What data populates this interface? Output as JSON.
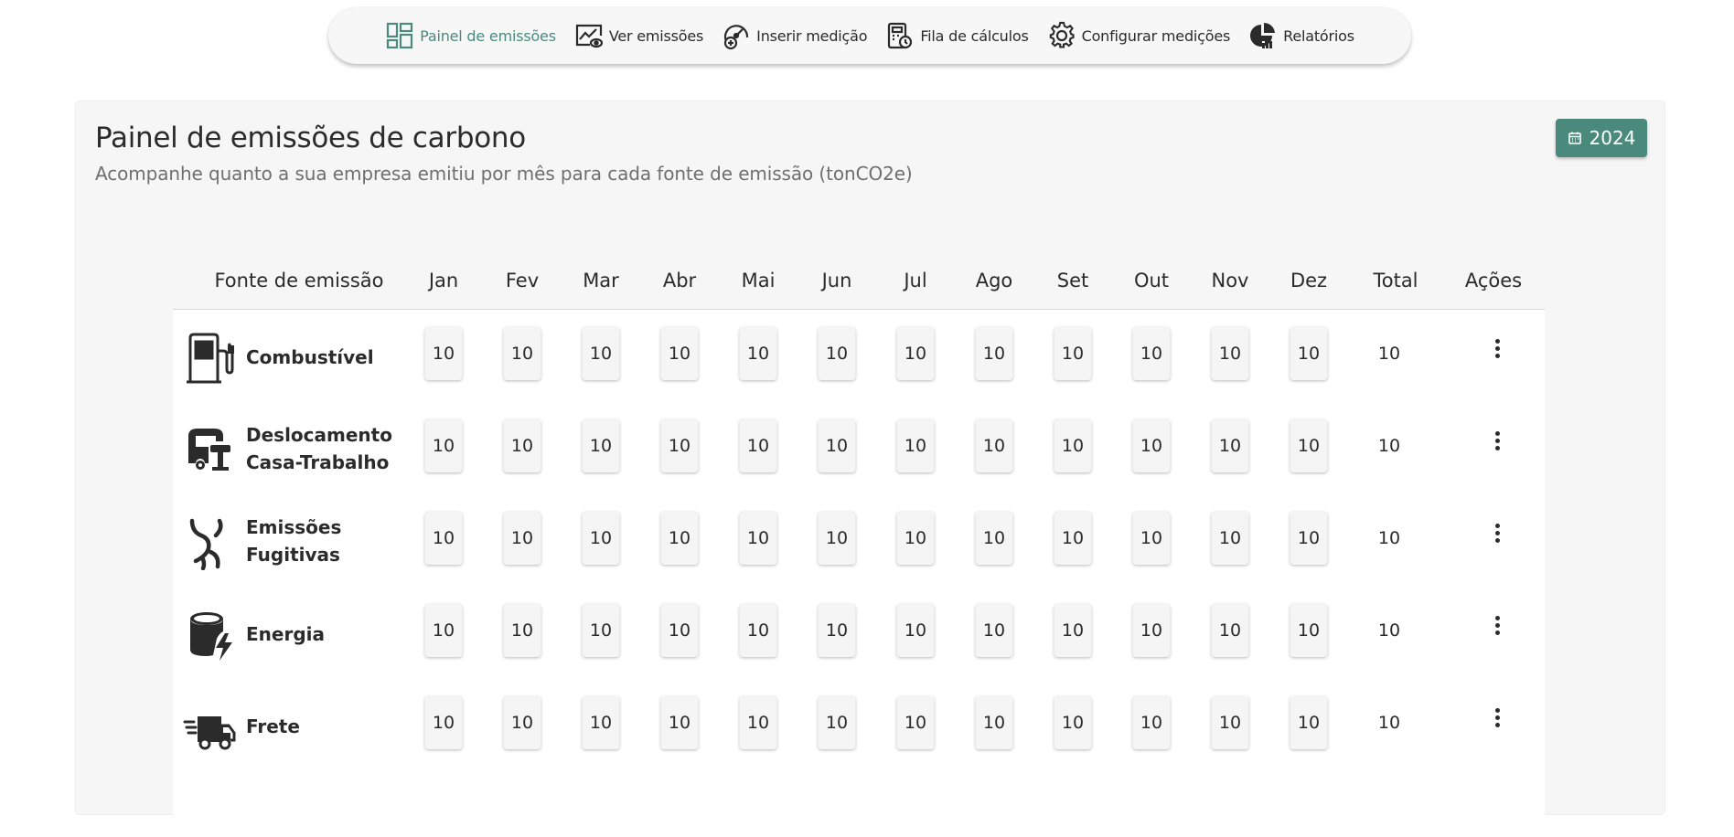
{
  "nav": {
    "items": [
      {
        "label": "Painel de emissões",
        "icon": "dashboard-icon",
        "active": true
      },
      {
        "label": "Ver emissões",
        "icon": "chart-eye-icon",
        "active": false
      },
      {
        "label": "Inserir medição",
        "icon": "gauge-add-icon",
        "active": false
      },
      {
        "label": "Fila de cálculos",
        "icon": "calculator-queue-icon",
        "active": false
      },
      {
        "label": "Configurar medições",
        "icon": "gear-icon",
        "active": false
      },
      {
        "label": "Relatórios",
        "icon": "report-chart-icon",
        "active": false
      }
    ],
    "active_color": "#4a8a7c"
  },
  "header": {
    "title": "Painel de emissões de carbono",
    "subtitle": "Acompanhe quanto a sua empresa emitiu por mês para cada fonte de emissão (tonCO2e)",
    "year": "2024"
  },
  "colors": {
    "accent": "#4a8a7c",
    "card_bg": "#f6f6f6",
    "text": "#2b2b2b"
  },
  "table": {
    "columns": [
      "Fonte de emissão",
      "Jan",
      "Fev",
      "Mar",
      "Abr",
      "Mai",
      "Jun",
      "Jul",
      "Ago",
      "Set",
      "Out",
      "Nov",
      "Dez",
      "Total",
      "Ações"
    ],
    "rows": [
      {
        "name_lines": [
          "Combustível"
        ],
        "icon": "fuel-pump-icon",
        "values": [
          "10",
          "10",
          "10",
          "10",
          "10",
          "10",
          "10",
          "10",
          "10",
          "10",
          "10",
          "10"
        ],
        "total": "10"
      },
      {
        "name_lines": [
          "Deslocamento",
          "Casa-Trabalho"
        ],
        "icon": "commute-icon",
        "values": [
          "10",
          "10",
          "10",
          "10",
          "10",
          "10",
          "10",
          "10",
          "10",
          "10",
          "10",
          "10"
        ],
        "total": "10"
      },
      {
        "name_lines": [
          "Emissões",
          "Fugitivas"
        ],
        "icon": "fugitive-pipes-icon",
        "values": [
          "10",
          "10",
          "10",
          "10",
          "10",
          "10",
          "10",
          "10",
          "10",
          "10",
          "10",
          "10"
        ],
        "total": "10"
      },
      {
        "name_lines": [
          "Energia"
        ],
        "icon": "energy-bolt-icon",
        "values": [
          "10",
          "10",
          "10",
          "10",
          "10",
          "10",
          "10",
          "10",
          "10",
          "10",
          "10",
          "10"
        ],
        "total": "10"
      },
      {
        "name_lines": [
          "Frete"
        ],
        "icon": "delivery-truck-icon",
        "values": [
          "10",
          "10",
          "10",
          "10",
          "10",
          "10",
          "10",
          "10",
          "10",
          "10",
          "10",
          "10"
        ],
        "total": "10"
      }
    ]
  }
}
